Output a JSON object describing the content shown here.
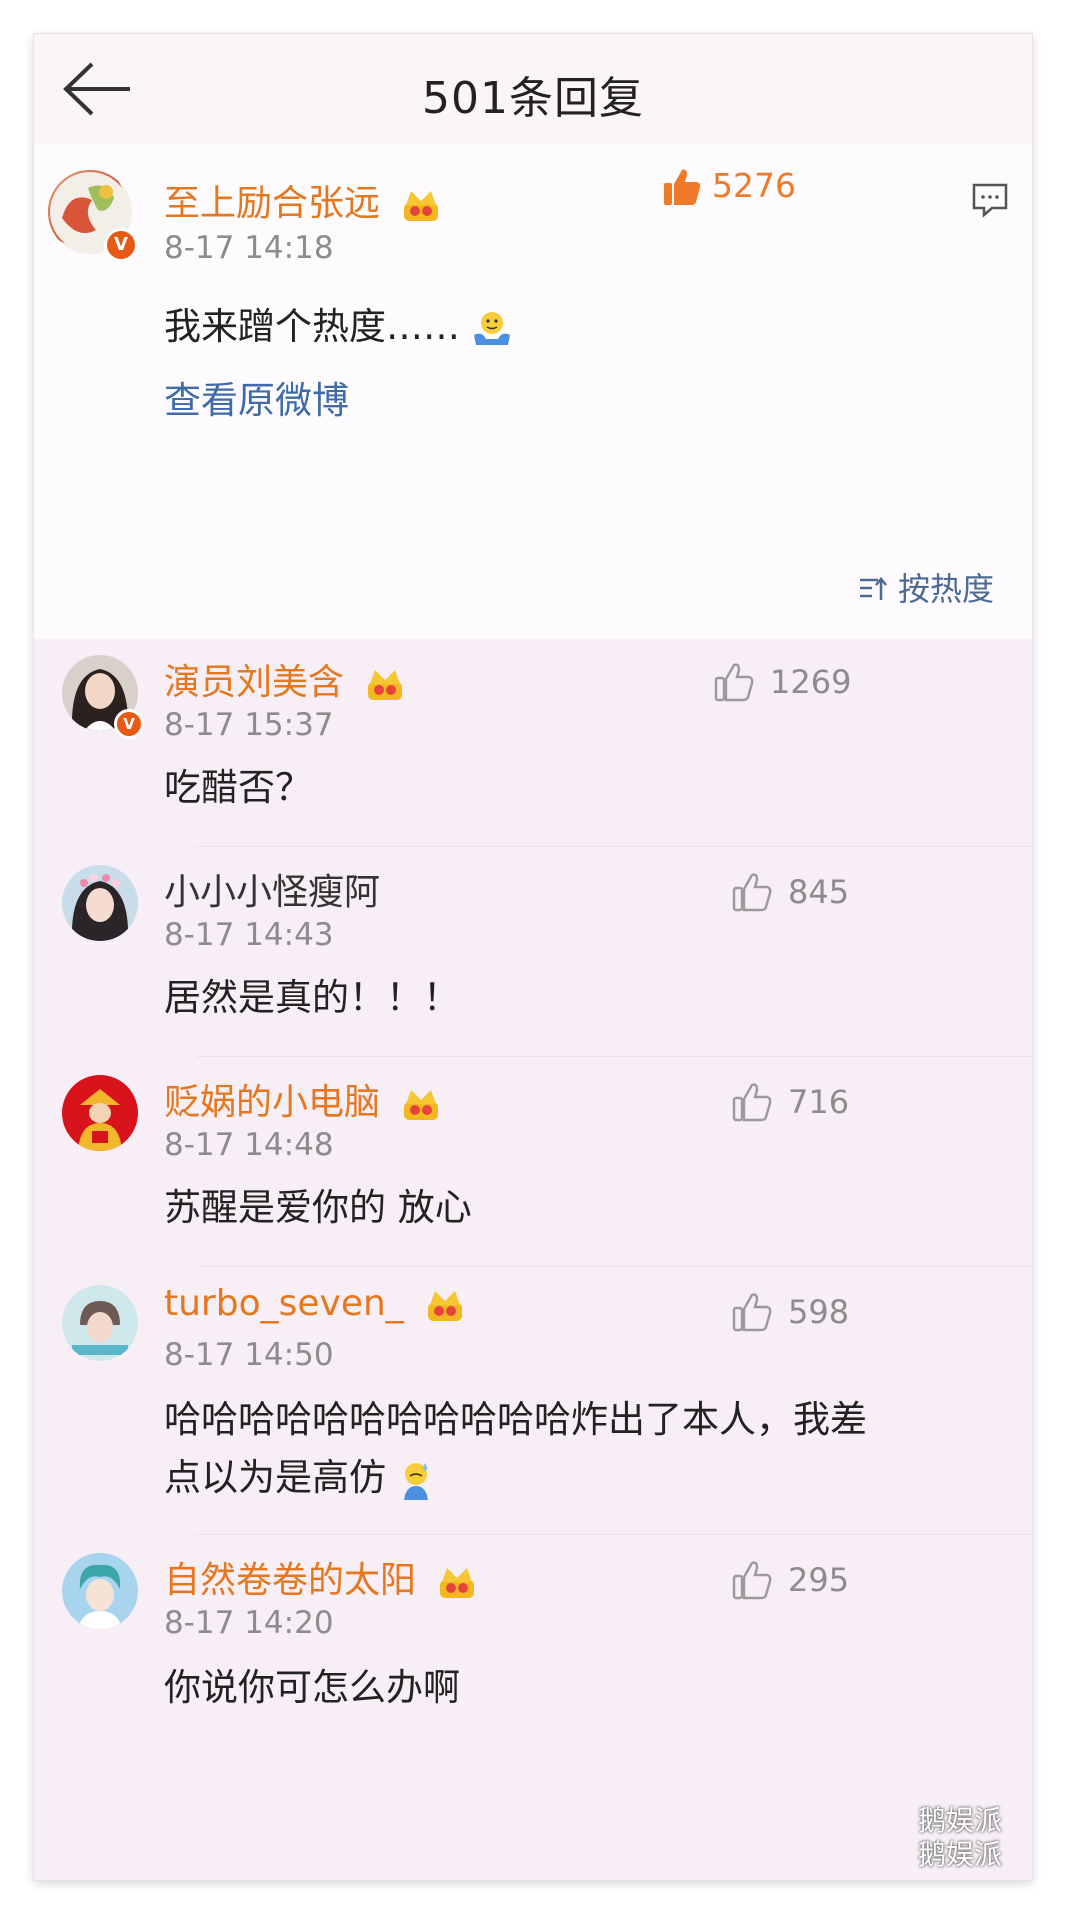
{
  "header": {
    "title": "501条回复"
  },
  "original": {
    "username": "至上励合张远",
    "time": "8-17 14:18",
    "text": "我来蹭个热度……",
    "emoji": "shrug-emoji",
    "view_original": "查看原微博",
    "likes": "5276",
    "sort_label": "按热度"
  },
  "replies": [
    {
      "username": "演员刘美含",
      "time": "8-17 15:37",
      "text": "吃醋否？",
      "likes": "1269",
      "verified": true,
      "crown": true
    },
    {
      "username": "小小小怪瘦阿",
      "time": "8-17 14:43",
      "text": "居然是真的！！！",
      "likes": "845",
      "verified": false,
      "crown": false
    },
    {
      "username": "贬娲的小电脑",
      "time": "8-17 14:48",
      "text": "苏醒是爱你的 放心",
      "likes": "716",
      "verified": false,
      "crown": true
    },
    {
      "username": "turbo_seven_",
      "time": "8-17 14:50",
      "text_line1": "哈哈哈哈哈哈哈哈哈哈哈炸出了本人，我差",
      "text_line2": "点以为是高仿",
      "likes": "598",
      "verified": false,
      "crown": true
    },
    {
      "username": "自然卷卷的太阳",
      "time": "8-17 14:20",
      "text": "你说你可怎么办啊",
      "likes": "295",
      "verified": false,
      "crown": true
    }
  ],
  "watermark": {
    "line1": "鹅娱派",
    "line2": "鹅娱派"
  },
  "colors": {
    "accent_orange": "#e5771f",
    "link_blue": "#3f6ca8",
    "like_orange": "#ef7a2a"
  }
}
